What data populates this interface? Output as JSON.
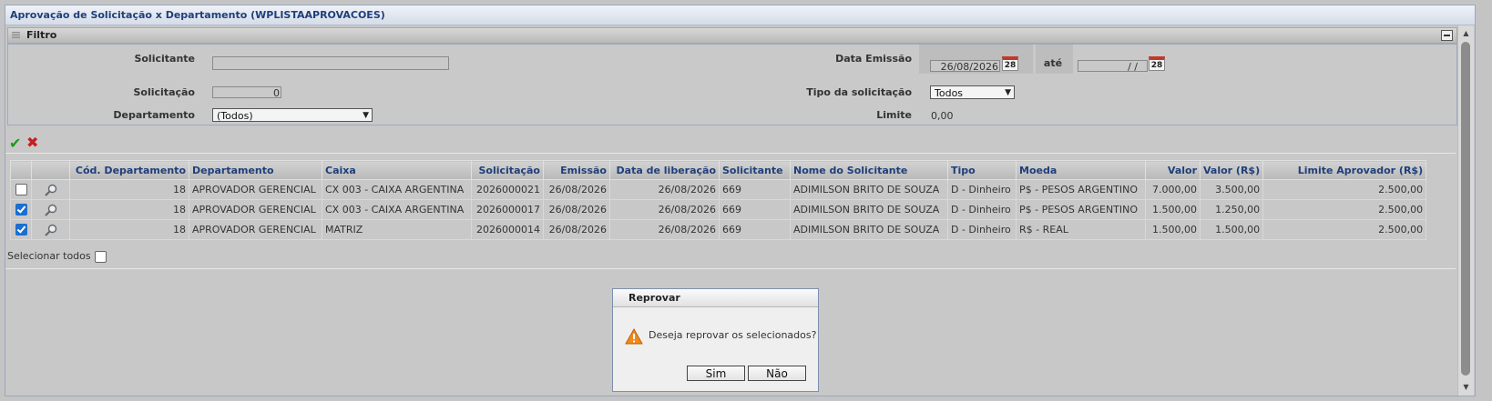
{
  "window": {
    "title": "Aprovação de Solicitação x Departamento (WPLISTAAPROVACOES)"
  },
  "filter": {
    "header": "Filtro",
    "solicitante_label": "Solicitante",
    "solicitante_value": "",
    "solicitacao_label": "Solicitação",
    "solicitacao_value": "0",
    "departamento_label": "Departamento",
    "departamento_value": "(Todos)",
    "data_emissao_label": "Data Emissão",
    "data_emissao_value": "26/08/2026",
    "ate_label": "até",
    "ate_value": "/ /",
    "calendar_day": "28",
    "tipo_label": "Tipo da solicitação",
    "tipo_value": "Todos",
    "limite_label": "Limite",
    "limite_value": "0,00"
  },
  "actions": {
    "approve_icon": "check-icon",
    "reject_icon": "x-icon"
  },
  "table": {
    "headers": [
      "Cód. Departamento",
      "Departamento",
      "Caixa",
      "Solicitação",
      "Emissão",
      "Data de liberação",
      "Solicitante",
      "Nome do Solicitante",
      "Tipo",
      "Moeda",
      "Valor",
      "Valor (R$)",
      "Limite Aprovador (R$)"
    ],
    "rows": [
      {
        "checked": false,
        "cod": "18",
        "departamento": "APROVADOR GERENCIAL",
        "caixa": "CX 003 - CAIXA ARGENTINA",
        "solicitacao": "2026000021",
        "emissao": "26/08/2026",
        "liberacao": "26/08/2026",
        "solicitante": "669",
        "nome": "ADIMILSON BRITO DE SOUZA",
        "tipo": "D - Dinheiro",
        "moeda": "P$ - PESOS ARGENTINO",
        "valor": "7.000,00",
        "valor_rs": "3.500,00",
        "limite": "2.500,00"
      },
      {
        "checked": true,
        "cod": "18",
        "departamento": "APROVADOR GERENCIAL",
        "caixa": "CX 003 - CAIXA ARGENTINA",
        "solicitacao": "2026000017",
        "emissao": "26/08/2026",
        "liberacao": "26/08/2026",
        "solicitante": "669",
        "nome": "ADIMILSON BRITO DE SOUZA",
        "tipo": "D - Dinheiro",
        "moeda": "P$ - PESOS ARGENTINO",
        "valor": "1.500,00",
        "valor_rs": "1.250,00",
        "limite": "2.500,00"
      },
      {
        "checked": true,
        "cod": "18",
        "departamento": "APROVADOR GERENCIAL",
        "caixa": "MATRIZ",
        "solicitacao": "2026000014",
        "emissao": "26/08/2026",
        "liberacao": "26/08/2026",
        "solicitante": "669",
        "nome": "ADIMILSON BRITO DE SOUZA",
        "tipo": "D - Dinheiro",
        "moeda": "R$ - REAL",
        "valor": "1.500,00",
        "valor_rs": "1.500,00",
        "limite": "2.500,00"
      }
    ]
  },
  "select_all": {
    "label": "Selecionar todos",
    "checked": false
  },
  "dialog": {
    "title": "Reprovar",
    "message": "Deseja reprovar os selecionados?",
    "yes_label": "Sim",
    "no_label": "Não"
  },
  "colors": {
    "header_text": "#1f3f7a",
    "approve": "#1e9a1e",
    "reject": "#c81e1e",
    "check_on": "#1a6fd0"
  }
}
